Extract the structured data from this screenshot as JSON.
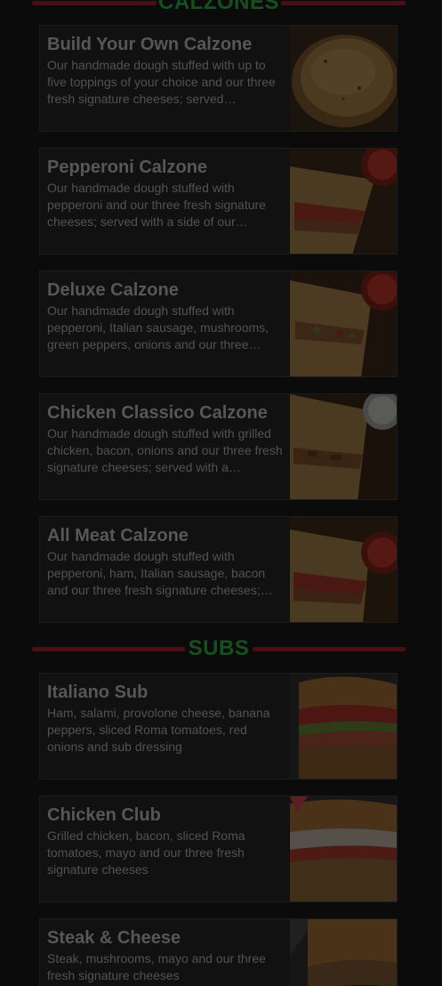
{
  "sections": {
    "calzones": {
      "title": "CALZONES",
      "items": [
        {
          "name": "Build Your Own Calzone",
          "description": "Our handmade dough stuffed with up to five toppings of your choice and our three fresh signature cheeses; served…",
          "image": "calzone-photo"
        },
        {
          "name": "Pepperoni Calzone",
          "description": "Our handmade dough stuffed with pepperoni and our three fresh signature cheeses; served with a side of our…",
          "image": "calzone-photo"
        },
        {
          "name": "Deluxe Calzone",
          "description": "Our handmade dough stuffed with pepperoni, Italian sausage, mushrooms, green peppers, onions and our three…",
          "image": "calzone-photo"
        },
        {
          "name": "Chicken Classico Calzone",
          "description": "Our handmade dough stuffed with grilled chicken, bacon, onions and our three fresh signature cheeses; served with a…",
          "image": "calzone-photo"
        },
        {
          "name": "All Meat Calzone",
          "description": "Our handmade dough stuffed with pepperoni, ham, Italian sausage, bacon and our three fresh signature cheeses;…",
          "image": "calzone-photo"
        }
      ]
    },
    "subs": {
      "title": "SUBS",
      "items": [
        {
          "name": "Italiano Sub",
          "description": "Ham, salami, provolone cheese, banana peppers, sliced Roma tomatoes, red onions and sub dressing",
          "image": "sub-photo"
        },
        {
          "name": "Chicken Club",
          "description": "Grilled chicken, bacon, sliced Roma tomatoes, mayo and our three fresh signature cheeses",
          "image": "sub-photo"
        },
        {
          "name": "Steak & Cheese",
          "description": "Steak, mushrooms, mayo and our three fresh signature cheeses",
          "image": "sub-photo"
        }
      ]
    }
  },
  "colors": {
    "background": "#0b0b0b",
    "card": "#111111",
    "text": "#575757",
    "section_title": "#16501f",
    "section_rule": "#4a0f12"
  }
}
